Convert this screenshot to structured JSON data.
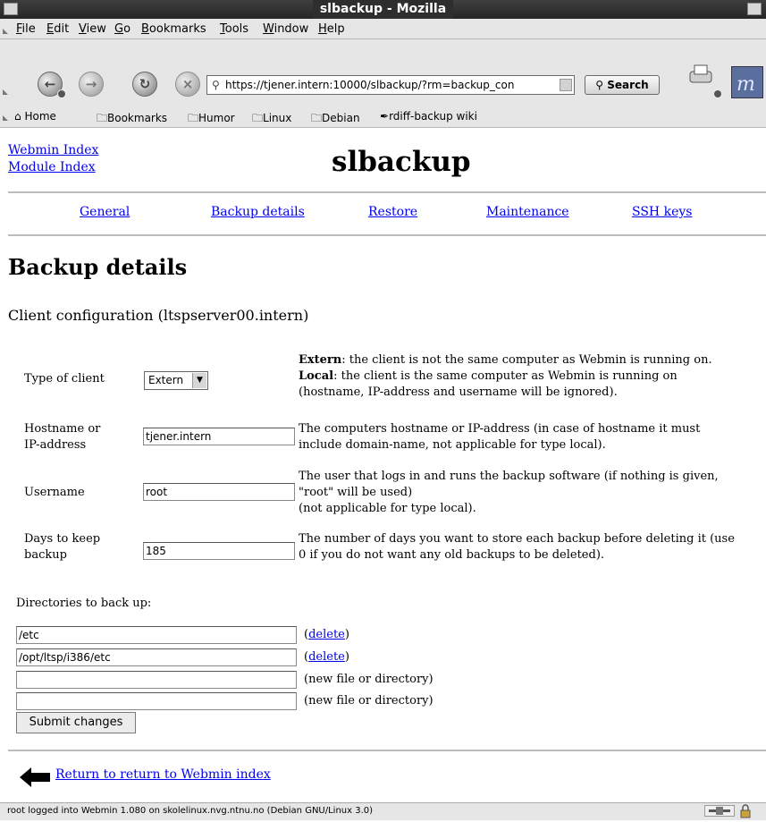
{
  "window": {
    "title": "slbackup - Mozilla"
  },
  "menu": {
    "items": [
      {
        "pre": "",
        "accel": "F",
        "post": "ile"
      },
      {
        "pre": "",
        "accel": "E",
        "post": "dit"
      },
      {
        "pre": "",
        "accel": "V",
        "post": "iew"
      },
      {
        "pre": "",
        "accel": "G",
        "post": "o"
      },
      {
        "pre": "",
        "accel": "B",
        "post": "ookmarks"
      },
      {
        "pre": "",
        "accel": "T",
        "post": "ools"
      },
      {
        "pre": "",
        "accel": "W",
        "post": "indow"
      },
      {
        "pre": "",
        "accel": "H",
        "post": "elp"
      }
    ]
  },
  "navbar": {
    "url": "https://tjener.intern:10000/slbackup/?rm=backup_con",
    "search_label": "Search"
  },
  "bookmarks": {
    "home": "Home",
    "items": [
      "Bookmarks",
      "Humor",
      "Linux",
      "Debian",
      "rdiff-backup wiki"
    ]
  },
  "header": {
    "webmin_index": "Webmin Index",
    "module_index": "Module Index",
    "title": "slbackup"
  },
  "tabs": [
    "General",
    "Backup details",
    "Restore",
    "Maintenance",
    "SSH keys"
  ],
  "page": {
    "heading": "Backup details",
    "subheading": "Client configuration (ltspserver00.intern)"
  },
  "form": {
    "type_label": "Type of client",
    "type_value": "Extern",
    "type_desc": {
      "extern_bold": "Extern",
      "extern_text": ": the client is not the same computer as Webmin is running on.",
      "local_bold": "Local",
      "local_text": ": the client is the same computer as Webmin is running on",
      "local_text2": "(hostname, IP-address and username will be ignored)."
    },
    "hostname_label_1": "Hostname or",
    "hostname_label_2": "IP-address",
    "hostname_value": "tjener.intern",
    "hostname_desc_1": "The computers hostname or IP-address (in case of hostname it must",
    "hostname_desc_2": "include domain-name, not applicable for type local).",
    "username_label": "Username",
    "username_value": "root",
    "username_desc_1": "The user that logs in and runs the backup software (if nothing is given,",
    "username_desc_2": "\"root\" will be used)",
    "username_desc_3": "(not applicable for type local).",
    "days_label_1": "Days to keep",
    "days_label_2": "backup",
    "days_value": "185",
    "days_desc_1": "The number of days you want to store each backup before deleting it (use",
    "days_desc_2": "0 if you do not want any old backups to be deleted).",
    "dirs_label": "Directories to back up:",
    "dirs": [
      {
        "value": "/etc",
        "action": "delete"
      },
      {
        "value": "/opt/ltsp/i386/etc",
        "action": "delete"
      },
      {
        "value": "",
        "note": "(new file or directory)"
      },
      {
        "value": "",
        "note": "(new file or directory)"
      }
    ],
    "submit_label": "Submit changes"
  },
  "footer": {
    "return_link": "Return to return to Webmin index"
  },
  "status": {
    "text": "root logged into Webmin 1.080 on skolelinux.nvg.ntnu.no (Debian GNU/Linux 3.0)"
  }
}
